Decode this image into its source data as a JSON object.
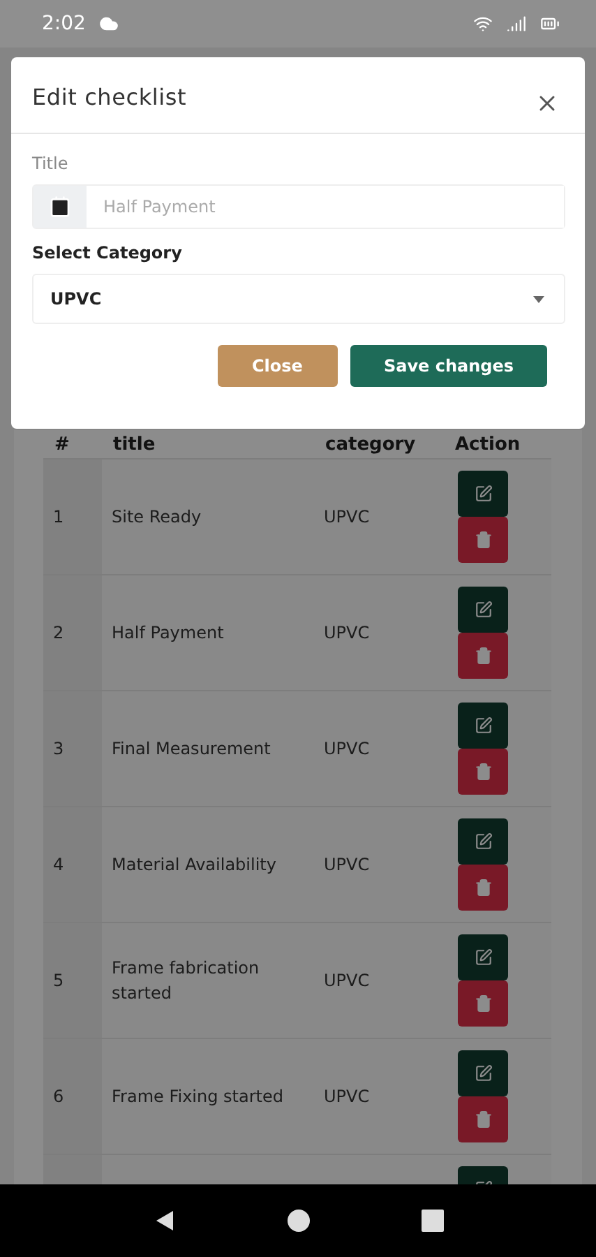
{
  "status_bar": {
    "time": "2:02"
  },
  "table": {
    "columns": [
      "#",
      "title",
      "category",
      "Action"
    ],
    "rows": [
      {
        "number": "1",
        "title": "Site Ready",
        "category": "UPVC"
      },
      {
        "number": "2",
        "title": "Half Payment",
        "category": "UPVC"
      },
      {
        "number": "3",
        "title": "Final Measurement",
        "category": "UPVC"
      },
      {
        "number": "4",
        "title": "Material Availability",
        "category": "UPVC"
      },
      {
        "number": "5",
        "title": "Frame fabrication started",
        "category": "UPVC"
      },
      {
        "number": "6",
        "title": "Frame Fixing started",
        "category": "UPVC"
      }
    ],
    "more_rows_below": true
  },
  "dialog": {
    "title": "Edit checklist",
    "title_label": "Title",
    "title_field": {
      "placeholder": "Half Payment"
    },
    "category_label": "Select Category",
    "category_select": {
      "value": "UPVC"
    },
    "buttons": [
      {
        "kind": "secondary",
        "label": "Close"
      },
      {
        "kind": "primary",
        "label": "Save changes"
      }
    ]
  }
}
